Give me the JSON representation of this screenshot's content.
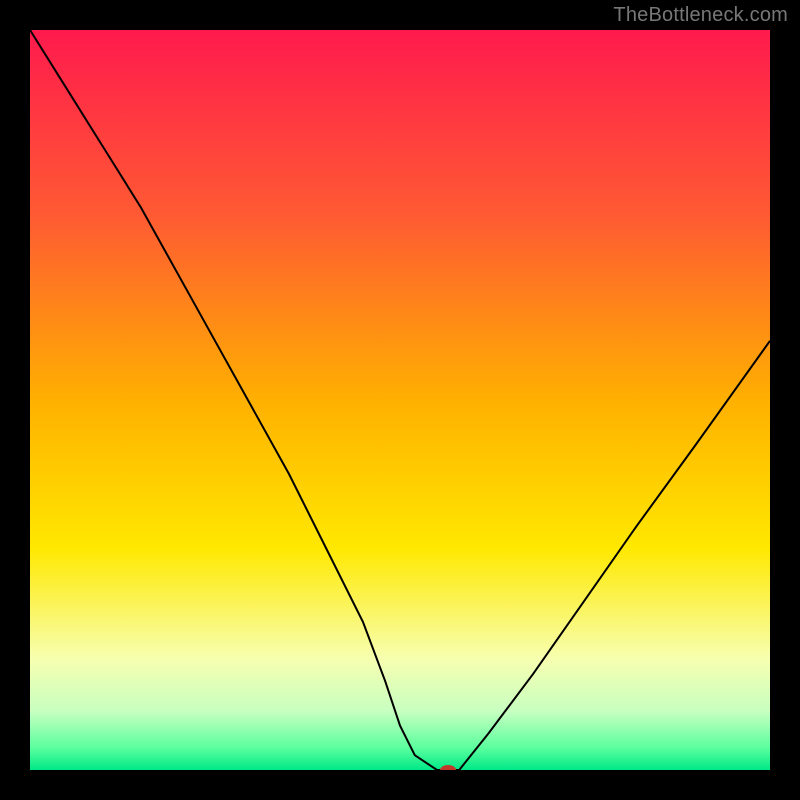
{
  "watermark": "TheBottleneck.com",
  "chart_data": {
    "type": "line",
    "title": "",
    "xlabel": "",
    "ylabel": "",
    "xlim": [
      0,
      100
    ],
    "ylim": [
      0,
      100
    ],
    "grid": false,
    "legend": false,
    "background": {
      "type": "vertical-gradient",
      "stops": [
        {
          "pos": 0.0,
          "color": "#ff1a4d"
        },
        {
          "pos": 0.25,
          "color": "#ff5a33"
        },
        {
          "pos": 0.5,
          "color": "#ffb000"
        },
        {
          "pos": 0.7,
          "color": "#ffe800"
        },
        {
          "pos": 0.85,
          "color": "#f7ffb0"
        },
        {
          "pos": 0.92,
          "color": "#c8ffc0"
        },
        {
          "pos": 0.97,
          "color": "#5bff9e"
        },
        {
          "pos": 1.0,
          "color": "#00e888"
        }
      ]
    },
    "series": [
      {
        "name": "bottleneck-curve",
        "color": "#000000",
        "stroke_width": 2,
        "x": [
          0,
          5,
          10,
          15,
          20,
          25,
          30,
          35,
          40,
          45,
          48,
          50,
          52,
          55,
          58,
          62,
          68,
          75,
          82,
          90,
          100
        ],
        "values": [
          100,
          92,
          84,
          76,
          67,
          58,
          49,
          40,
          30,
          20,
          12,
          6,
          2,
          0,
          0,
          5,
          13,
          23,
          33,
          44,
          58
        ]
      }
    ],
    "marker": {
      "name": "optimal-point",
      "x": 56.5,
      "y": 0,
      "color": "#c0392b",
      "rx": 8,
      "ry": 5
    }
  }
}
